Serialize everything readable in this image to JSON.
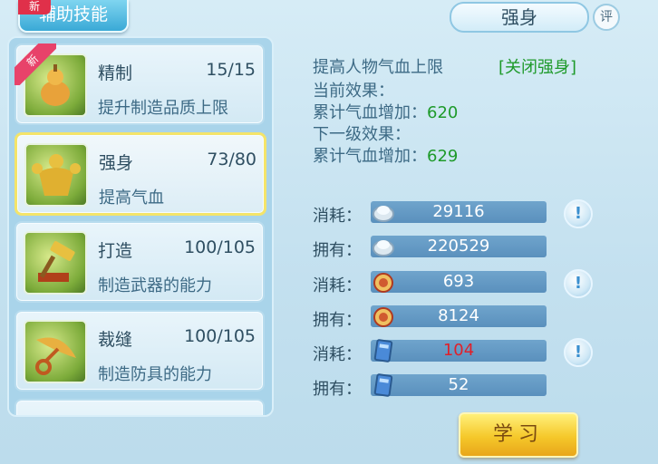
{
  "top": {
    "tab_label": "辅助技能",
    "tab_new_badge": "新",
    "title": "强身",
    "rate_label": "评"
  },
  "skills": [
    {
      "name": "精制",
      "level": "15/15",
      "desc": "提升制造品质上限",
      "badge": "新",
      "selected": false,
      "icon": "gourd-icon"
    },
    {
      "name": "强身",
      "level": "73/80",
      "desc": "提高气血",
      "selected": true,
      "icon": "muscle-man-icon"
    },
    {
      "name": "打造",
      "level": "100/105",
      "desc": "制造武器的能力",
      "selected": false,
      "icon": "hammer-anvil-icon"
    },
    {
      "name": "裁缝",
      "level": "100/105",
      "desc": "制造防具的能力",
      "selected": false,
      "icon": "scissors-icon"
    }
  ],
  "detail": {
    "headline": "提高人物气血上限",
    "close_link": "[关闭强身]",
    "current_label": "当前效果：",
    "current_text": "累计气血增加：",
    "current_value": "620",
    "next_label": "下一级效果：",
    "next_text": "累计气血增加：",
    "next_value": "629"
  },
  "resources": [
    {
      "label": "消耗：",
      "value": "29116",
      "icon": "silver-coin-icon",
      "hint": true,
      "hint_label": "!"
    },
    {
      "label": "拥有：",
      "value": "220529",
      "icon": "silver-coin-icon",
      "hint": false
    },
    {
      "label": "消耗：",
      "value": "693",
      "icon": "contribution-medal-icon",
      "hint": true,
      "hint_label": "!"
    },
    {
      "label": "拥有：",
      "value": "8124",
      "icon": "contribution-medal-icon",
      "hint": false
    },
    {
      "label": "消耗：",
      "value": "104",
      "icon": "skill-book-icon",
      "hint": true,
      "hint_label": "!",
      "value_color": "#e0202a"
    },
    {
      "label": "拥有：",
      "value": "52",
      "icon": "skill-book-icon",
      "hint": false
    }
  ],
  "learn_button": "学习"
}
